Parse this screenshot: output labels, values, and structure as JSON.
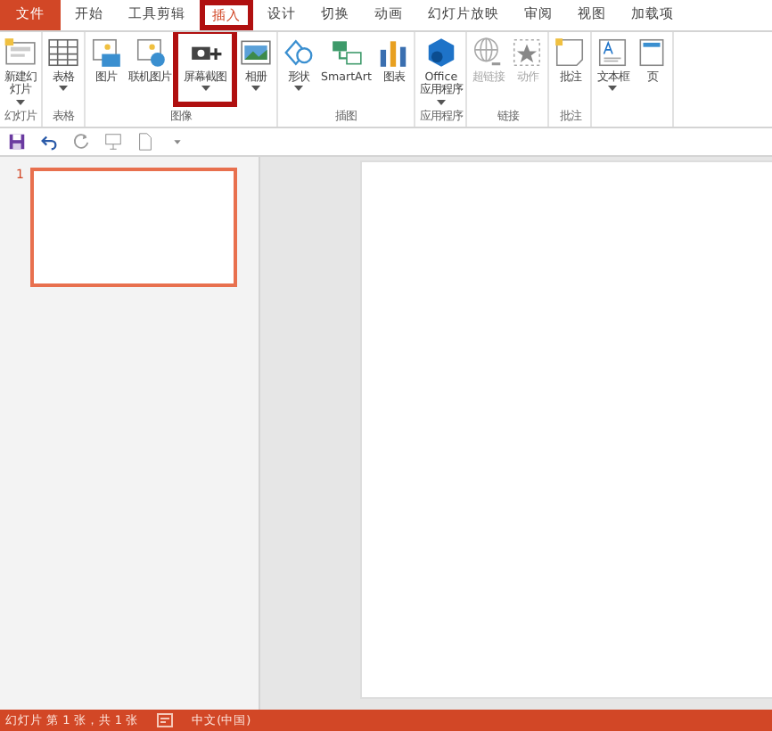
{
  "tabs": [
    {
      "label": "文件",
      "kind": "file",
      "selected": false,
      "highlighted": false
    },
    {
      "label": "开始",
      "kind": "tab",
      "selected": false,
      "highlighted": false
    },
    {
      "label": "工具剪辑",
      "kind": "tab",
      "selected": false,
      "highlighted": false
    },
    {
      "label": "插入",
      "kind": "tab",
      "selected": true,
      "highlighted": true
    },
    {
      "label": "设计",
      "kind": "tab",
      "selected": false,
      "highlighted": false
    },
    {
      "label": "切换",
      "kind": "tab",
      "selected": false,
      "highlighted": false
    },
    {
      "label": "动画",
      "kind": "tab",
      "selected": false,
      "highlighted": false
    },
    {
      "label": "幻灯片放映",
      "kind": "tab",
      "selected": false,
      "highlighted": false
    },
    {
      "label": "审阅",
      "kind": "tab",
      "selected": false,
      "highlighted": false
    },
    {
      "label": "视图",
      "kind": "tab",
      "selected": false,
      "highlighted": false
    },
    {
      "label": "加载项",
      "kind": "tab",
      "selected": false,
      "highlighted": false
    }
  ],
  "ribbon_groups": [
    {
      "label": "幻灯片",
      "buttons": [
        {
          "label": "新建幻灯片",
          "dropdown": true,
          "disabled": false,
          "highlighted": false
        }
      ]
    },
    {
      "label": "表格",
      "buttons": [
        {
          "label": "表格",
          "dropdown": true,
          "disabled": false,
          "highlighted": false
        }
      ]
    },
    {
      "label": "图像",
      "buttons": [
        {
          "label": "图片",
          "dropdown": false,
          "disabled": false,
          "highlighted": false
        },
        {
          "label": "联机图片",
          "dropdown": false,
          "disabled": false,
          "highlighted": false
        },
        {
          "label": "屏幕截图",
          "dropdown": true,
          "disabled": false,
          "highlighted": true
        },
        {
          "label": "相册",
          "dropdown": true,
          "disabled": false,
          "highlighted": false
        }
      ]
    },
    {
      "label": "插图",
      "buttons": [
        {
          "label": "形状",
          "dropdown": true,
          "disabled": false,
          "highlighted": false
        },
        {
          "label": "SmartArt",
          "dropdown": false,
          "disabled": false,
          "highlighted": false
        },
        {
          "label": "图表",
          "dropdown": false,
          "disabled": false,
          "highlighted": false
        }
      ]
    },
    {
      "label": "应用程序",
      "buttons": [
        {
          "label": "Office\n应用程序",
          "dropdown": true,
          "disabled": false,
          "highlighted": false
        }
      ]
    },
    {
      "label": "链接",
      "buttons": [
        {
          "label": "超链接",
          "dropdown": false,
          "disabled": true,
          "highlighted": false
        },
        {
          "label": "动作",
          "dropdown": false,
          "disabled": true,
          "highlighted": false
        }
      ]
    },
    {
      "label": "批注",
      "buttons": [
        {
          "label": "批注",
          "dropdown": false,
          "disabled": false,
          "highlighted": false
        }
      ]
    },
    {
      "buttons": [
        {
          "label": "文本框",
          "dropdown": true,
          "disabled": false,
          "highlighted": false
        },
        {
          "label": "页",
          "dropdown": false,
          "disabled": false,
          "highlighted": false
        }
      ]
    }
  ],
  "slides": [
    {
      "number": "1",
      "selected": true
    }
  ],
  "status_bar": {
    "slide_info": "幻灯片 第 1 张，共 1 张",
    "language": "中文(中国)"
  }
}
